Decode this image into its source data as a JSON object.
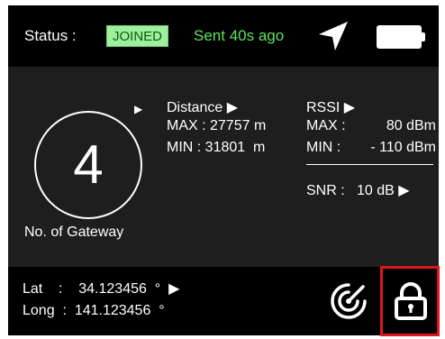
{
  "header": {
    "status_label": "Status :",
    "status_value": "JOINED",
    "sent_text": "Sent 40s ago",
    "nav_icon": "navigation-arrow-icon",
    "battery_icon": "battery-full-icon"
  },
  "gateway": {
    "count": "4",
    "label": "No. of Gateway",
    "arrow": "▶"
  },
  "distance": {
    "title": "Distance ▶",
    "max": "MAX : 27757 m",
    "min": "MIN : 31801  m"
  },
  "rssi": {
    "title": "RSSI ▶",
    "max_label": "MAX :",
    "max_value": "80 dBm",
    "min_label": "MIN :",
    "min_value": "- 110 dBm"
  },
  "snr": {
    "text": "SNR :   10 dB ▶"
  },
  "footer": {
    "lat": "Lat    :    34.123456  °  ▶",
    "long": "Long  :  141.123456  °",
    "radar_icon": "radar-icon",
    "lock_icon": "lock-icon"
  },
  "colors": {
    "background": "#1e1e1e",
    "bar": "#000000",
    "joined_bg": "#9ef09e",
    "sent_text": "#5fe35f",
    "lock_highlight": "#e0161e"
  }
}
